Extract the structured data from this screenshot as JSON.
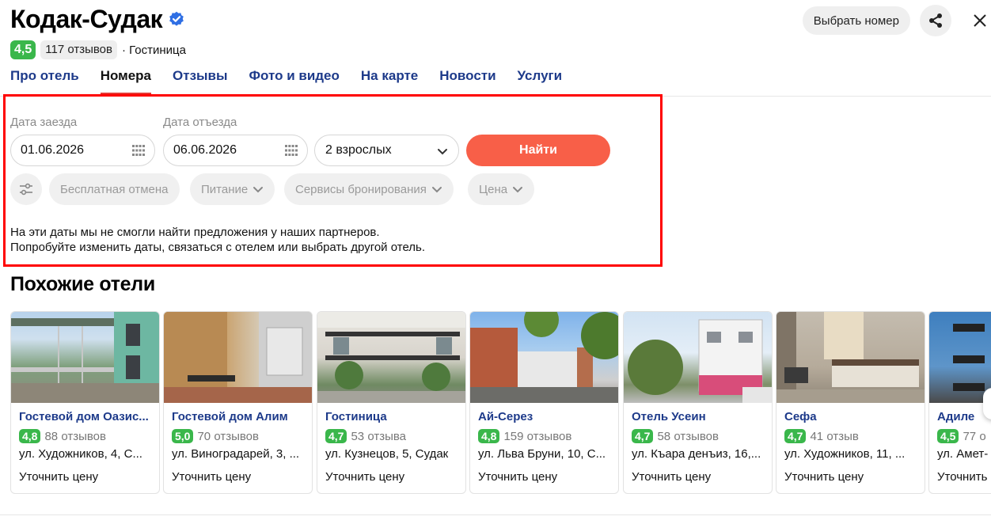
{
  "hotel": {
    "title": "Кодак-Судак",
    "rating": "4,5",
    "reviews": "117 отзывов",
    "type": "· Гостиница"
  },
  "header_actions": {
    "choose_room": "Выбрать номер"
  },
  "tabs": [
    {
      "label": "Про отель"
    },
    {
      "label": "Номера"
    },
    {
      "label": "Отзывы"
    },
    {
      "label": "Фото и видео"
    },
    {
      "label": "На карте"
    },
    {
      "label": "Новости"
    },
    {
      "label": "Услуги"
    }
  ],
  "active_tab": "Номера",
  "search": {
    "checkin_label": "Дата заезда",
    "checkin_value": "01.06.2026",
    "checkout_label": "Дата отъезда",
    "checkout_value": "06.06.2026",
    "guests_value": "2 взрослых",
    "find_button": "Найти"
  },
  "filters": {
    "free_cancel": "Бесплатная отмена",
    "meals": "Питание",
    "booking_services": "Сервисы бронирования",
    "price": "Цена"
  },
  "no_offers": {
    "line1": "На эти даты мы не смогли найти предложения у наших партнеров.",
    "line2": "Попробуйте изменить даты, связаться с отелем или выбрать другой отель."
  },
  "similar": {
    "title": "Похожие отели",
    "price_label": "Уточнить цену",
    "cards": [
      {
        "name": "Гостевой дом Оазис...",
        "rating": "4,8",
        "reviews": "88 отзывов",
        "address": "ул. Художников, 4, С..."
      },
      {
        "name": "Гостевой дом Алим",
        "rating": "5,0",
        "reviews": "70 отзывов",
        "address": "ул. Виноградарей, 3, ..."
      },
      {
        "name": "Гостиница",
        "rating": "4,7",
        "reviews": "53 отзыва",
        "address": "ул. Кузнецов, 5, Судак"
      },
      {
        "name": "Ай-Серез",
        "rating": "4,8",
        "reviews": "159 отзывов",
        "address": "ул. Льва Бруни, 10, С..."
      },
      {
        "name": "Отель Усеин",
        "rating": "4,7",
        "reviews": "58 отзывов",
        "address": "ул. Къара денъиз, 16,..."
      },
      {
        "name": "Сефа",
        "rating": "4,7",
        "reviews": "41 отзыв",
        "address": "ул. Художников, 11, ..."
      },
      {
        "name": "Адиле",
        "rating": "4,5",
        "reviews": "77 о",
        "address": "ул. Амет-"
      }
    ]
  },
  "colors": {
    "accent_red": "#f85f48",
    "rating_green": "#3ab74b",
    "link_blue": "#1d3a8a",
    "highlight_border": "#ff0000"
  }
}
